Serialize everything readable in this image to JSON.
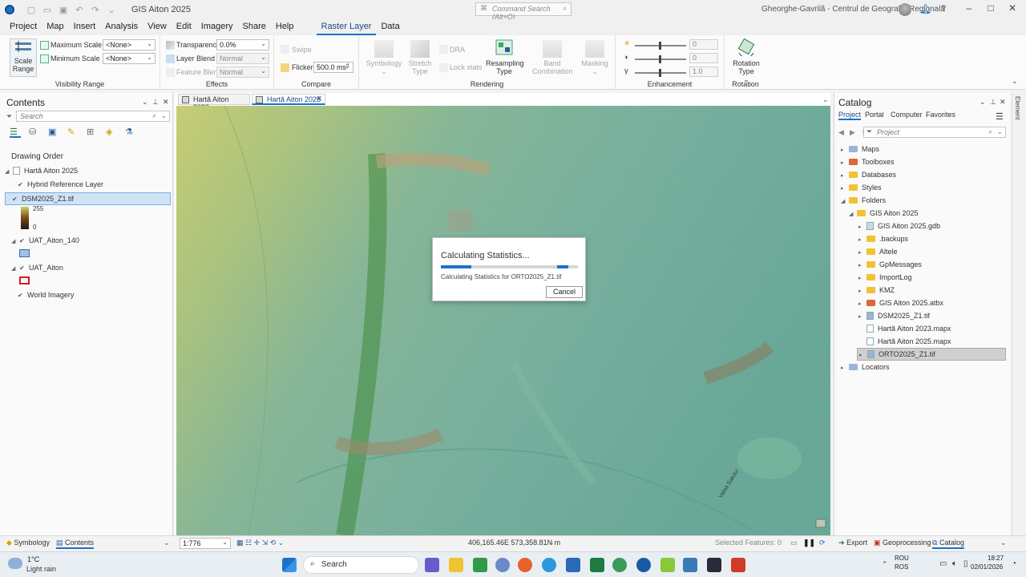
{
  "window": {
    "title": "GIS Aiton 2025",
    "command_search_placeholder": "Command Search (Alt+Q)",
    "user": "Gheorghe-Gavrilă - Centrul de Geografie Regională",
    "help": "?",
    "minimize": "–",
    "maximize": "□",
    "close": "✕"
  },
  "menu": [
    "Project",
    "Map",
    "Insert",
    "Analysis",
    "View",
    "Edit",
    "Imagery",
    "Share",
    "Help",
    "Raster Layer",
    "Data"
  ],
  "menu_active": "Raster Layer",
  "ribbon": {
    "visibility": {
      "label": "Visibility Range",
      "scale_range": "Scale Range",
      "max_scale_label": "Maximum Scale",
      "max_scale_value": "<None>",
      "min_scale_label": "Minimum Scale",
      "min_scale_value": "<None>"
    },
    "effects": {
      "label": "Effects",
      "transparency_label": "Transparency",
      "transparency_value": "0.0%",
      "layer_blend_label": "Layer Blend",
      "layer_blend_value": "Normal",
      "feature_blend_label": "Feature Blend",
      "feature_blend_value": "Normal"
    },
    "compare": {
      "label": "Compare",
      "swipe": "Swipe",
      "flicker_label": "Flicker",
      "flicker_value": "500.0",
      "flicker_unit": "ms"
    },
    "rendering": {
      "label": "Rendering",
      "symbology": "Symbology",
      "stretch_type": "Stretch Type",
      "dra": "DRA",
      "lock_stats": "Lock stats",
      "resampling_type": "Resampling Type",
      "band_combination": "Band Combination",
      "masking": "Masking"
    },
    "enhancement": {
      "label": "Enhancement",
      "brightness": "0",
      "contrast": "0",
      "gamma": "1.0"
    },
    "rotation": {
      "label": "Rotation",
      "rotation_type": "Rotation Type"
    }
  },
  "contents": {
    "title": "Contents",
    "search_placeholder": "Search",
    "drawing_order": "Drawing Order",
    "map_name": "Hartă Aiton 2025",
    "layers": [
      {
        "name": "Hybrid Reference Layer"
      },
      {
        "name": "DSM2025_Z1.tif",
        "legend_high": "255",
        "legend_low": "0"
      },
      {
        "name": "UAT_Aiton_140"
      },
      {
        "name": "UAT_Aiton"
      },
      {
        "name": "World Imagery"
      }
    ]
  },
  "map": {
    "tabs": [
      "Hartă Aiton 2023",
      "Hartă Aiton 2025"
    ],
    "active_tab": "Hartă Aiton 2025",
    "scale": "1:776",
    "coordinates": "406,165.46E 573,358.81N m",
    "selected_features": "Selected Features: 0",
    "label_road": "Valea Satului"
  },
  "dialog": {
    "title": "Calculating Statistics...",
    "message": "Calculating Statistics for ORTO2025_Z1.tif",
    "cancel": "Cancel",
    "progress": 0.85
  },
  "catalog": {
    "title": "Catalog",
    "tabs": [
      "Project",
      "Portal",
      "Computer",
      "Favorites"
    ],
    "active_tab": "Project",
    "search_placeholder": "Project",
    "root": [
      "Maps",
      "Toolboxes",
      "Databases",
      "Styles",
      "Folders"
    ],
    "folder_root": "GIS Aiton 2025",
    "folder_items": [
      "GIS Aiton 2025.gdb",
      ".backups",
      "Altele",
      "GpMessages",
      "ImportLog",
      "KMZ",
      "GIS Aiton 2025.atbx",
      "DSM2025_Z1.tif",
      "Hartă Aiton 2023.mapx",
      "Hartă Aiton 2025.mapx",
      "ORTO2025_Z1.tif"
    ],
    "selected_item": "ORTO2025_Z1.tif",
    "locators": "Locators"
  },
  "bottom_tabs": {
    "symbology": "Symbology",
    "contents": "Contents",
    "export": "Export",
    "geoprocessing": "Geoprocessing",
    "catalog": "Catalog"
  },
  "elements_strip": "Element",
  "taskbar": {
    "weather_temp": "1°C",
    "weather_desc": "Light rain",
    "search": "Search",
    "lang1": "ROU",
    "lang2": "ROS",
    "time": "18:27",
    "date": "02/01/2026"
  },
  "colors": {
    "accent": "#1a73c8",
    "dem_low": "#3e8f7f",
    "dem_mid": "#9bc68a",
    "dem_high": "#c8d36a"
  }
}
